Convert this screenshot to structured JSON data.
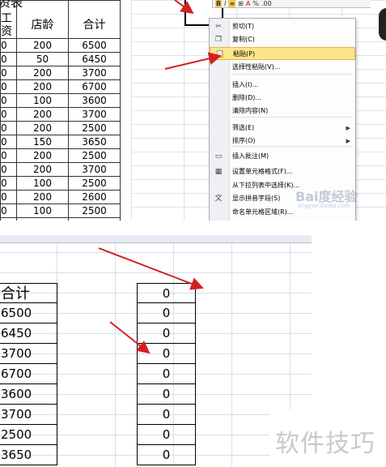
{
  "top": {
    "title_fragment": "资表",
    "headers": [
      "工资",
      "店龄",
      "合计"
    ],
    "rows": [
      [
        "0",
        "200",
        "6500"
      ],
      [
        "0",
        "50",
        "6450"
      ],
      [
        "0",
        "200",
        "3700"
      ],
      [
        "0",
        "200",
        "6700"
      ],
      [
        "0",
        "100",
        "3600"
      ],
      [
        "0",
        "200",
        "3700"
      ],
      [
        "0",
        "200",
        "2500"
      ],
      [
        "0",
        "150",
        "3650"
      ],
      [
        "0",
        "200",
        "2500"
      ],
      [
        "0",
        "200",
        "3700"
      ],
      [
        "0",
        "100",
        "2500"
      ],
      [
        "0",
        "200",
        "2600"
      ],
      [
        "0",
        "100",
        "2500"
      ],
      [
        "0",
        "50",
        "3550"
      ]
    ],
    "mini_toolbar": [
      "B",
      "I",
      "≡",
      "⊞",
      "A",
      "%",
      ".00"
    ]
  },
  "context_menu": {
    "items": [
      {
        "label": "剪切(T)",
        "icon": "scissors-icon",
        "glyph": "✂",
        "submenu": false,
        "highlighted": false
      },
      {
        "label": "复制(C)",
        "icon": "copy-icon",
        "glyph": "❐",
        "submenu": false,
        "highlighted": false
      },
      {
        "label": "粘贴(P)",
        "icon": "paste-icon",
        "glyph": "📋",
        "submenu": false,
        "highlighted": true
      },
      {
        "label": "选择性粘贴(V)...",
        "icon": "",
        "glyph": "",
        "submenu": false,
        "highlighted": false
      },
      {
        "label": "插入(I)...",
        "icon": "",
        "glyph": "",
        "submenu": false,
        "highlighted": false
      },
      {
        "label": "删除(D)...",
        "icon": "",
        "glyph": "",
        "submenu": false,
        "highlighted": false
      },
      {
        "label": "清除内容(N)",
        "icon": "",
        "glyph": "",
        "submenu": false,
        "highlighted": false
      },
      {
        "label": "筛选(E)",
        "icon": "",
        "glyph": "",
        "submenu": true,
        "highlighted": false
      },
      {
        "label": "排序(O)",
        "icon": "",
        "glyph": "",
        "submenu": true,
        "highlighted": false
      },
      {
        "label": "插入批注(M)",
        "icon": "comment-icon",
        "glyph": "▭",
        "submenu": false,
        "highlighted": false
      },
      {
        "label": "设置单元格格式(F)...",
        "icon": "format-cells-icon",
        "glyph": "▦",
        "submenu": false,
        "highlighted": false
      },
      {
        "label": "从下拉列表中选择(K)...",
        "icon": "",
        "glyph": "",
        "submenu": false,
        "highlighted": false
      },
      {
        "label": "显示拼音字段(S)",
        "icon": "phonetic-icon",
        "glyph": "文",
        "submenu": false,
        "highlighted": false
      },
      {
        "label": "命名单元格区域(R)...",
        "icon": "",
        "glyph": "",
        "submenu": false,
        "highlighted": false
      }
    ],
    "highlight_color": "#fde58a"
  },
  "watermarks": {
    "baidu": "Bai度经验",
    "baidu_sub": "jingyan.baidu.com",
    "site": "软件技巧"
  },
  "bottom": {
    "header_a": "合计",
    "col_a": [
      "6500",
      "6450",
      "3700",
      "6700",
      "3600",
      "3700",
      "2500",
      "3650"
    ],
    "col_e": [
      "0",
      "0",
      "0",
      "0",
      "0",
      "0",
      "0",
      "0",
      "0"
    ]
  },
  "accent_arrow_color": "#d42020"
}
